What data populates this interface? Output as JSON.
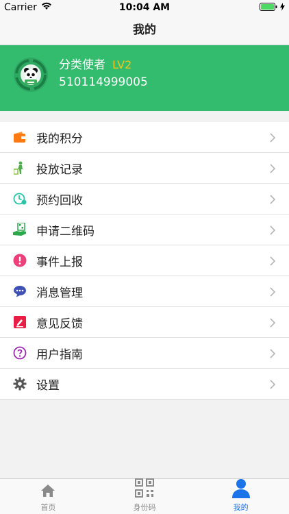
{
  "status_bar": {
    "carrier": "Carrier",
    "time": "10:04 AM"
  },
  "nav": {
    "title": "我的"
  },
  "profile": {
    "name": "分类使者",
    "level": "LV2",
    "phone": "510114999005"
  },
  "menu": [
    {
      "label": "我的积分",
      "icon": "wallet-icon"
    },
    {
      "label": "投放记录",
      "icon": "recycle-drop-icon"
    },
    {
      "label": "预约回收",
      "icon": "clock-icon"
    },
    {
      "label": "申请二维码",
      "icon": "qr-hand-icon"
    },
    {
      "label": "事件上报",
      "icon": "report-icon"
    },
    {
      "label": "消息管理",
      "icon": "chat-icon"
    },
    {
      "label": "意见反馈",
      "icon": "feedback-icon"
    },
    {
      "label": "用户指南",
      "icon": "help-icon"
    },
    {
      "label": "设置",
      "icon": "gear-icon"
    }
  ],
  "tabs": [
    {
      "label": "首页",
      "icon": "home-icon"
    },
    {
      "label": "身份码",
      "icon": "qr-code-icon"
    },
    {
      "label": "我的",
      "icon": "user-icon",
      "active": true
    }
  ],
  "colors": {
    "accent": "#33bb6e",
    "level": "#f5c518",
    "active_tab": "#1a73e8"
  }
}
